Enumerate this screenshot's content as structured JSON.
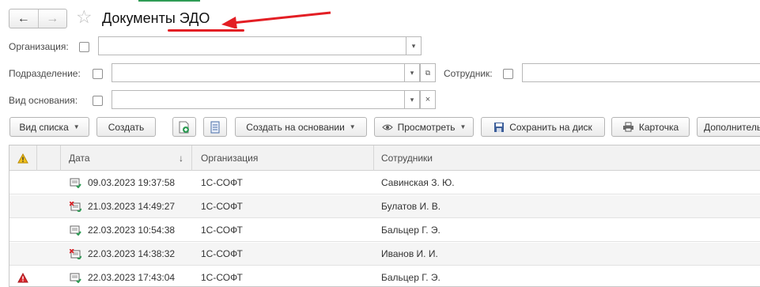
{
  "window": {
    "title": "Документы ЭДО"
  },
  "nav": {
    "back_icon": "arrow-left-icon",
    "forward_icon": "arrow-right-icon",
    "favorite_icon": "star-icon"
  },
  "filters": {
    "organization": {
      "label": "Организация:",
      "value": ""
    },
    "department": {
      "label": "Подразделение:",
      "value": ""
    },
    "employee": {
      "label": "Сотрудник:",
      "value": ""
    },
    "basis_type": {
      "label": "Вид основания:",
      "value": ""
    }
  },
  "toolbar": {
    "list_view": "Вид списка",
    "create": "Создать",
    "create_based_on": "Создать на основании",
    "view": "Просмотреть",
    "save_to_disk": "Сохранить на диск",
    "card": "Карточка",
    "more": "Дополнитель"
  },
  "table": {
    "columns": {
      "date": "Дата",
      "organization": "Организация",
      "employees": "Сотрудники"
    },
    "sort_indicator": "↓",
    "rows": [
      {
        "warning": false,
        "doc_status": "ok",
        "date": "09.03.2023 19:37:58",
        "organization": "1С-СОФТ",
        "employees": "Савинская З. Ю."
      },
      {
        "warning": false,
        "doc_status": "error",
        "date": "21.03.2023 14:49:27",
        "organization": "1С-СОФТ",
        "employees": "Булатов И. В."
      },
      {
        "warning": false,
        "doc_status": "ok",
        "date": "22.03.2023 10:54:38",
        "organization": "1С-СОФТ",
        "employees": "Бальцер Г. Э."
      },
      {
        "warning": false,
        "doc_status": "error",
        "date": "22.03.2023 14:38:32",
        "organization": "1С-СОФТ",
        "employees": "Иванов И. И."
      },
      {
        "warning": true,
        "doc_status": "ok",
        "date": "22.03.2023 17:43:04",
        "organization": "1С-СОФТ",
        "employees": "Бальцер Г. Э."
      }
    ]
  },
  "colors": {
    "accent_red": "#e31e24",
    "warning_yellow": "#f2c21b",
    "error_red": "#d9262c",
    "ok_green": "#2e9c55"
  }
}
